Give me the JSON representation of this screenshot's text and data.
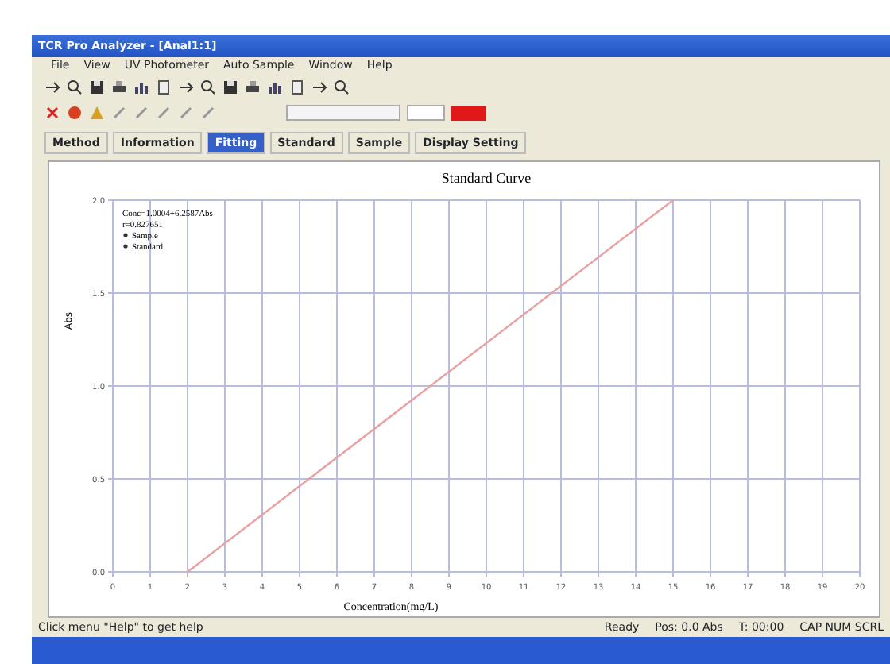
{
  "window": {
    "title": "TCR Pro Analyzer - [Anal1:1]"
  },
  "menu": [
    "File",
    "View",
    "UV Photometer",
    "Auto Sample",
    "Window",
    "Help"
  ],
  "tabs": [
    {
      "label": "Method",
      "selected": false
    },
    {
      "label": "Information",
      "selected": false
    },
    {
      "label": "Fitting",
      "selected": true
    },
    {
      "label": "Standard",
      "selected": false
    },
    {
      "label": "Sample",
      "selected": false
    },
    {
      "label": "Display Setting",
      "selected": false
    }
  ],
  "chart": {
    "equation": "Conc=1.0004+6.2587Abs",
    "r": "r=0.827651",
    "legend": [
      "Sample",
      "Standard"
    ],
    "chart_data": {
      "type": "line",
      "title": "Standard Curve",
      "xlabel": "Concentration(mg/L)",
      "ylabel": "Abs",
      "x": [
        2,
        15
      ],
      "series": [
        {
          "color": "#e8a0a0",
          "values": [
            0,
            2
          ]
        }
      ],
      "grid": true,
      "xlim": [
        0,
        20
      ],
      "ylim": [
        0,
        2
      ],
      "xticks": [
        0,
        1,
        2,
        3,
        4,
        5,
        6,
        7,
        8,
        9,
        10,
        11,
        12,
        13,
        14,
        15,
        16,
        17,
        18,
        19,
        20
      ],
      "yticks": [
        {
          "value": 0,
          "label": "0.0"
        },
        {
          "value": 0.5,
          "label": "0.5"
        },
        {
          "value": 1,
          "label": "1.0"
        },
        {
          "value": 1.5,
          "label": "1.5"
        },
        {
          "value": 2,
          "label": "2.0"
        }
      ]
    }
  },
  "status_bar": [
    "Click menu \"Help\" to get help",
    "Ready",
    "Pos: 0.0 Abs",
    "T: 00:00",
    "CAP NUM SCRL"
  ]
}
